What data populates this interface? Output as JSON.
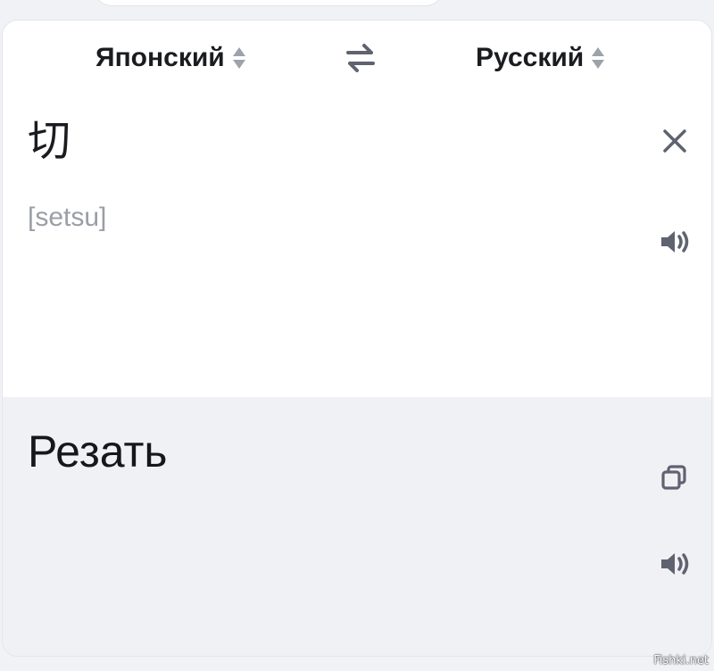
{
  "languages": {
    "source": "Японский",
    "target": "Русский"
  },
  "icons": {
    "source_sort": "sort-updown-icon",
    "target_sort": "sort-updown-icon",
    "swap": "swap-arrows-icon",
    "clear": "close-icon",
    "speak_source": "speaker-icon",
    "copy": "copy-icon",
    "speak_target": "speaker-icon"
  },
  "source": {
    "text": "切",
    "transliteration": "[setsu]"
  },
  "target": {
    "text": "Резать"
  },
  "watermark": "Fishki.net",
  "colors": {
    "icon": "#5f6370",
    "muted": "#9a9ea6",
    "target_bg": "#f0f1f5"
  }
}
